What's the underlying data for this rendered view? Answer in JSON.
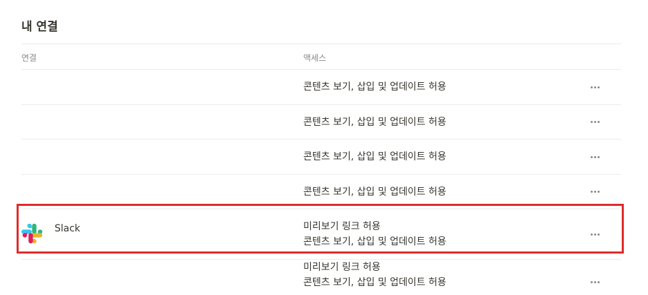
{
  "page": {
    "title": "내 연결"
  },
  "table": {
    "headers": {
      "connection": "연결",
      "access": "액세스"
    },
    "rows": [
      {
        "name": "",
        "access": [
          "콘텐츠 보기, 삽입 및 업데이트 허용"
        ]
      },
      {
        "name": "",
        "access": [
          "콘텐츠 보기, 삽입 및 업데이트 허용"
        ]
      },
      {
        "name": "",
        "access": [
          "콘텐츠 보기, 삽입 및 업데이트 허용"
        ]
      },
      {
        "name": "",
        "access": [
          "콘텐츠 보기, 삽입 및 업데이트 허용"
        ]
      },
      {
        "name": "Slack",
        "icon": "slack-logo-icon",
        "access": [
          "미리보기 링크 허용",
          "콘텐츠 보기, 삽입 및 업데이트 허용"
        ],
        "highlighted": true
      },
      {
        "name": "",
        "access": [
          "미리보기 링크 허용",
          "콘텐츠 보기, 삽입 및 업데이트 허용"
        ]
      }
    ]
  },
  "colors": {
    "highlight": "#e02a2a",
    "text": "#37352f",
    "muted": "#8a8985",
    "divider": "#ececea"
  }
}
